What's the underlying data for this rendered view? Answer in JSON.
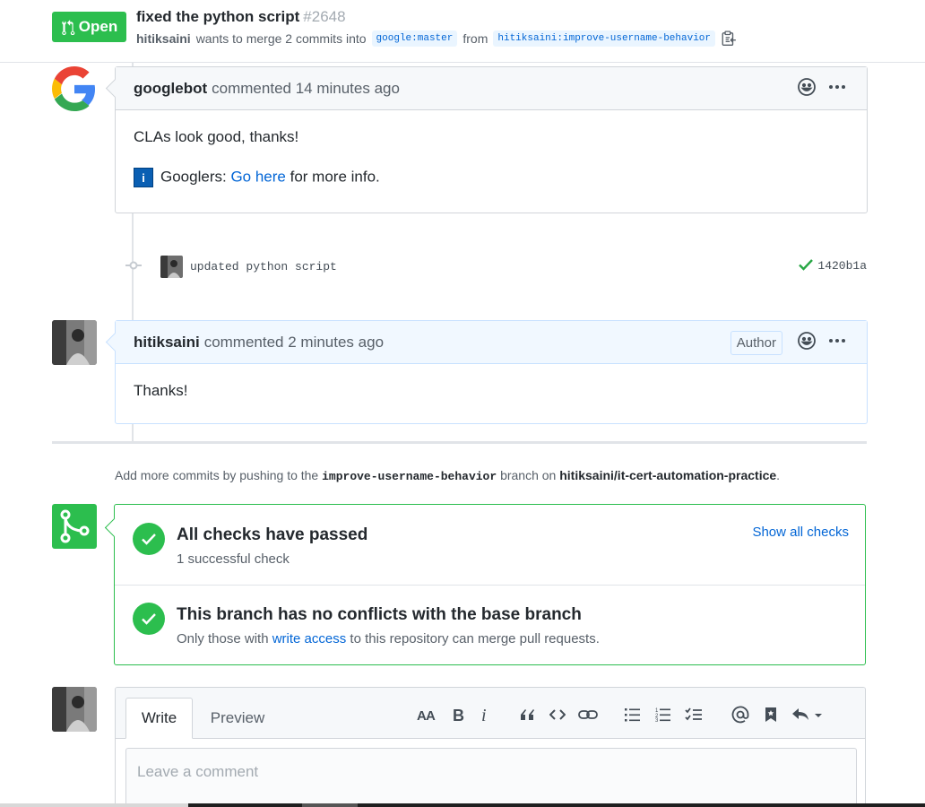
{
  "header": {
    "state": "Open",
    "title": "fixed the python script",
    "number": "#2648",
    "author": "hitiksaini",
    "merge_text": "wants to merge 2 commits into",
    "base_branch": "google:master",
    "from_text": "from",
    "head_branch": "hitiksaini:improve-username-behavior"
  },
  "comments": [
    {
      "author": "googlebot",
      "action": "commented 14 minutes ago",
      "body_line1": "CLAs look good, thanks!",
      "info_icon": "i",
      "googlers_label": "Googlers:",
      "link_text": "Go here",
      "suffix": "for more info."
    },
    {
      "author": "hitiksaini",
      "action": "commented 2 minutes ago",
      "author_label": "Author",
      "body": "Thanks!"
    }
  ],
  "commit": {
    "message": "updated python script",
    "sha": "1420b1a",
    "status_color": "#28a745"
  },
  "push_hint": {
    "prefix": "Add more commits by pushing to the",
    "branch": "improve-username-behavior",
    "middle": "branch on",
    "repo": "hitiksaini/it-cert-automation-practice",
    "suffix": "."
  },
  "merge": {
    "checks_heading": "All checks have passed",
    "checks_sub": "1 successful check",
    "show_checks": "Show all checks",
    "conflicts_heading": "This branch has no conflicts with the base branch",
    "conflicts_sub_prefix": "Only those with",
    "conflicts_link": "write access",
    "conflicts_sub_suffix": "to this repository can merge pull requests.",
    "accent": "#2cbe4e"
  },
  "new_comment": {
    "tab_write": "Write",
    "tab_preview": "Preview",
    "placeholder": "Leave a comment"
  }
}
